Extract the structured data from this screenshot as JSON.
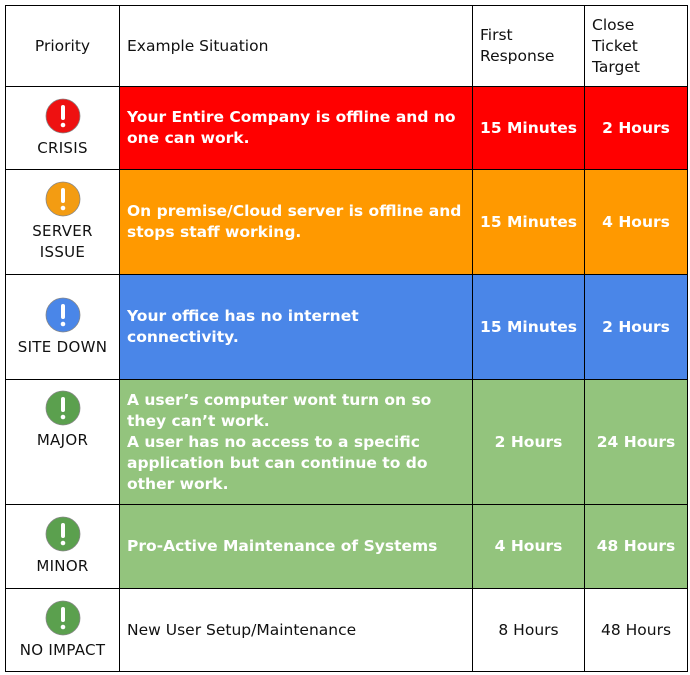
{
  "headers": {
    "priority": "Priority",
    "situation": "Example Situation",
    "first_response": "First Response",
    "close_target": "Close Ticket Target"
  },
  "colors": {
    "crisis": "#ff0000",
    "server_issue": "#ff9900",
    "site_down": "#4a86e8",
    "major": "#93c47d",
    "minor": "#93c47d",
    "no_impact": "#ffffff",
    "icon_red": "#ee1111",
    "icon_orange": "#f39c12",
    "icon_blue": "#4a86e8",
    "icon_green": "#5ba04e"
  },
  "rows": [
    {
      "priority": "CRISIS",
      "icon": "exclamation-circle-icon",
      "situation": [
        "Your Entire Company is offline and no one can work."
      ],
      "first_response": "15 Minutes",
      "close_target": "2 Hours"
    },
    {
      "priority": "SERVER ISSUE",
      "icon": "exclamation-circle-icon",
      "situation": [
        "On premise/Cloud server is offline and stops staff working."
      ],
      "first_response": "15 Minutes",
      "close_target": "4 Hours"
    },
    {
      "priority": "SITE DOWN",
      "icon": "exclamation-circle-icon",
      "situation": [
        "Your office has no internet connectivity."
      ],
      "first_response": "15 Minutes",
      "close_target": "2 Hours"
    },
    {
      "priority": "MAJOR",
      "icon": "exclamation-circle-icon",
      "situation": [
        "A user’s computer wont turn on so they can’t work.",
        "A user has no access to a specific application but can continue to do other work."
      ],
      "first_response": "2 Hours",
      "close_target": "24 Hours"
    },
    {
      "priority": "MINOR",
      "icon": "exclamation-circle-icon",
      "situation": [
        "Pro-Active Maintenance of Systems"
      ],
      "first_response": "4 Hours",
      "close_target": "48 Hours"
    },
    {
      "priority": "NO IMPACT",
      "icon": "exclamation-circle-icon",
      "situation": [
        "New User Setup/Maintenance"
      ],
      "first_response": "8 Hours",
      "close_target": "48 Hours"
    }
  ]
}
